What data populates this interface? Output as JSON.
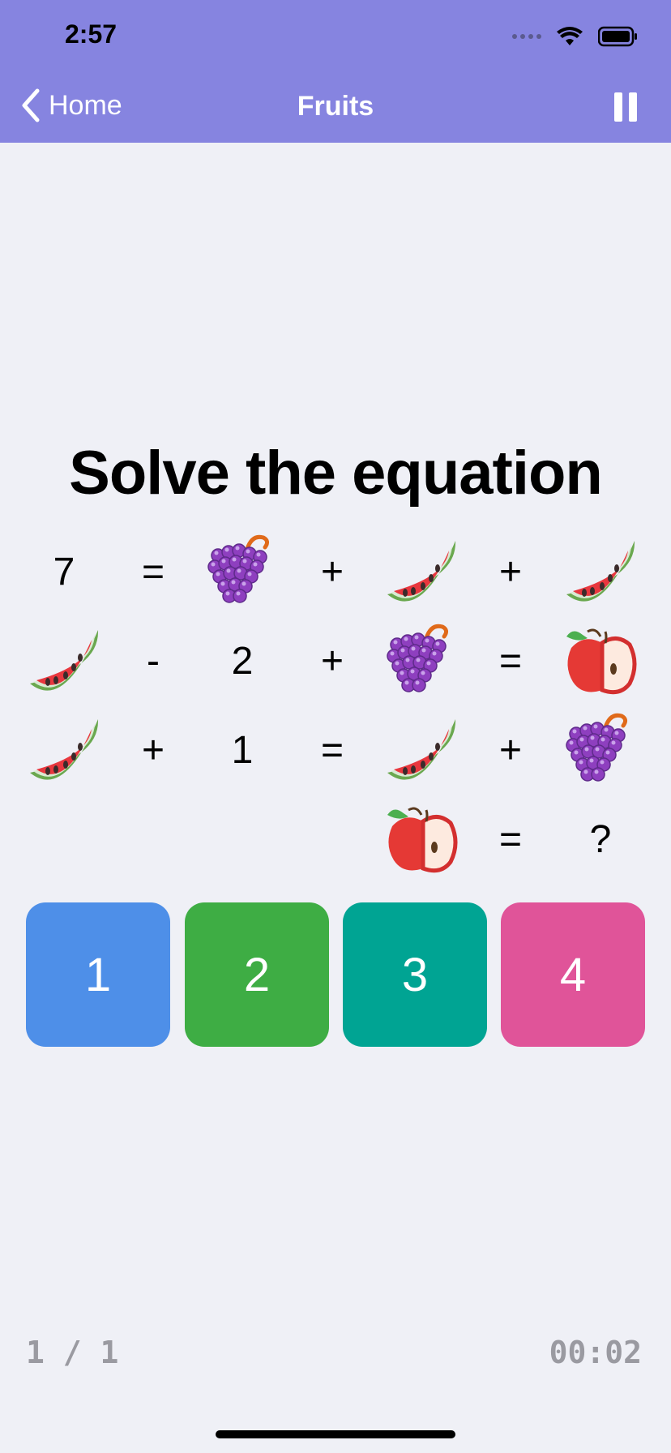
{
  "status_bar": {
    "time": "2:57"
  },
  "nav": {
    "back_label": "Home",
    "title": "Fruits"
  },
  "heading": "Solve the equation",
  "equations": [
    [
      "7",
      "=",
      "grapes",
      "+",
      "watermelon",
      "+",
      "watermelon"
    ],
    [
      "watermelon",
      "-",
      "2",
      "+",
      "grapes",
      "=",
      "apple"
    ],
    [
      "watermelon",
      "+",
      "1",
      "=",
      "watermelon",
      "+",
      "grapes"
    ],
    [
      "",
      "",
      "",
      "",
      "apple",
      "=",
      "?"
    ]
  ],
  "answers": [
    {
      "label": "1",
      "color": "#4e8fe8"
    },
    {
      "label": "2",
      "color": "#3ead44"
    },
    {
      "label": "3",
      "color": "#00a493"
    },
    {
      "label": "4",
      "color": "#e05499"
    }
  ],
  "footer": {
    "progress": "1 / 1",
    "timer": "00:02"
  }
}
